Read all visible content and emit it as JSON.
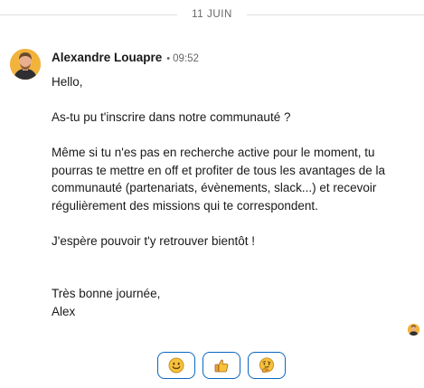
{
  "divider": {
    "date": "11 JUIN"
  },
  "message": {
    "sender": "Alexandre Louapre",
    "separator": "•",
    "time": "09:52",
    "paragraphs": [
      "Hello,",
      "As-tu pu t'inscrire dans notre communauté ?",
      "Même si tu n'es pas en recherche active pour le moment, tu pourras te mettre en off et profiter de tous les avantages de la communauté (partenariats, évènements, slack...) et recevoir régulièrement des missions qui te correspondent.",
      "J'espère pouvoir t'y retrouver bientôt !",
      "Très bonne journée,",
      "Alex"
    ]
  },
  "avatar": {
    "icon": "profile-photo",
    "color": "#f2b33d"
  },
  "read_receipt": {
    "icon": "seen-by-avatar"
  },
  "reactions": [
    {
      "icon": "smiling-face-emoji"
    },
    {
      "icon": "thumbs-up-emoji"
    },
    {
      "icon": "thinking-face-emoji"
    }
  ],
  "colors": {
    "accent": "#0a66c2",
    "muted_text": "#666666",
    "body_text": "#191919",
    "emoji_yellow": "#f7c23a"
  }
}
